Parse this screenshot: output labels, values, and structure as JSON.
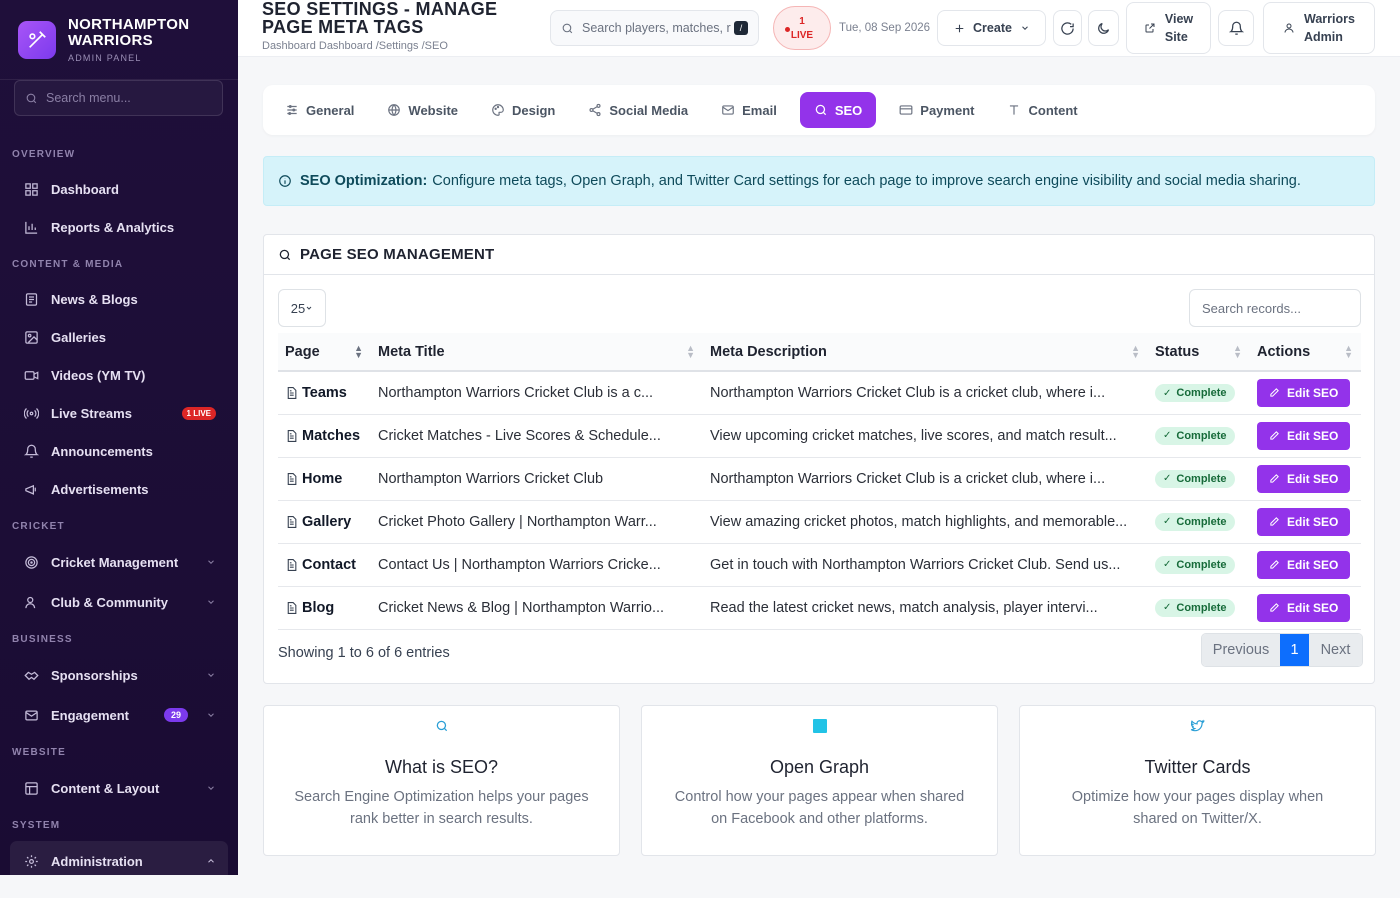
{
  "brand": {
    "name_line1": "NORTHAMPTON",
    "name_line2": "WARRIORS",
    "subtitle": "ADMIN PANEL"
  },
  "sidebar": {
    "search_placeholder": "Search menu...",
    "sections": {
      "overview": "OVERVIEW",
      "content_media": "CONTENT & MEDIA",
      "cricket": "CRICKET",
      "business": "BUSINESS",
      "website": "WEBSITE",
      "system": "SYSTEM"
    },
    "items": {
      "dashboard": "Dashboard",
      "reports": "Reports & Analytics",
      "news": "News & Blogs",
      "galleries": "Galleries",
      "videos": "Videos (YM TV)",
      "live_streams": "Live Streams",
      "live_streams_badge": "1 LIVE",
      "announcements": "Announcements",
      "advertisements": "Advertisements",
      "cricket_management": "Cricket Management",
      "club_community": "Club & Community",
      "sponsorships": "Sponsorships",
      "engagement": "Engagement",
      "engagement_badge": "29",
      "content_layout": "Content & Layout",
      "administration": "Administration"
    }
  },
  "header": {
    "title": "SEO SETTINGS - MANAGE PAGE META TAGS",
    "breadcrumb": "Dashboard  Dashboard  /Settings  /SEO",
    "search_placeholder": "Search players, matches, r",
    "search_kbd": "/",
    "live_count": "1",
    "live_label": "LIVE",
    "date": "Tue, 08 Sep 2026",
    "create_label": "Create",
    "view_site_line1": "View",
    "view_site_line2": "Site",
    "user_line1": "Warriors",
    "user_line2": "Admin"
  },
  "tabs": [
    "General",
    "Website",
    "Design",
    "Social Media",
    "Email",
    "SEO",
    "Payment",
    "Content"
  ],
  "alert": {
    "title": "SEO Optimization:",
    "text": "Configure meta tags, Open Graph, and Twitter Card settings for each page to improve search engine visibility and social media sharing."
  },
  "seo_table": {
    "heading": "PAGE SEO MANAGEMENT",
    "page_length": "25",
    "search_placeholder": "Search records...",
    "columns": [
      "Page",
      "Meta Title",
      "Meta Description",
      "Status",
      "Actions"
    ],
    "rows": [
      {
        "page": "Teams",
        "title": "Northampton Warriors Cricket Club is a c...",
        "desc": "Northampton Warriors Cricket Club is a cricket club, where i...",
        "status": "Complete",
        "action": "Edit SEO"
      },
      {
        "page": "Matches",
        "title": "Cricket Matches - Live Scores & Schedule...",
        "desc": "View upcoming cricket matches, live scores, and match result...",
        "status": "Complete",
        "action": "Edit SEO"
      },
      {
        "page": "Home",
        "title": "Northampton Warriors Cricket Club",
        "desc": "Northampton Warriors Cricket Club is a cricket club, where i...",
        "status": "Complete",
        "action": "Edit SEO"
      },
      {
        "page": "Gallery",
        "title": "Cricket Photo Gallery | Northampton Warr...",
        "desc": "View amazing cricket photos, match highlights, and memorable...",
        "status": "Complete",
        "action": "Edit SEO"
      },
      {
        "page": "Contact",
        "title": "Contact Us | Northampton Warriors Cricke...",
        "desc": "Get in touch with Northampton Warriors Cricket Club. Send us...",
        "status": "Complete",
        "action": "Edit SEO"
      },
      {
        "page": "Blog",
        "title": "Cricket News & Blog | Northampton Warrio...",
        "desc": "Read the latest cricket news, match analysis, player intervi...",
        "status": "Complete",
        "action": "Edit SEO"
      }
    ],
    "entries_text": "Showing 1 to 6 of 6 entries",
    "pager": {
      "prev": "Previous",
      "current": "1",
      "next": "Next"
    }
  },
  "info_cards": [
    {
      "icon": "search-icon",
      "title": "What is SEO?",
      "text": "Search Engine Optimization helps your pages rank better in search results."
    },
    {
      "icon": "open-graph-icon",
      "title": "Open Graph",
      "text": "Control how your pages appear when shared on Facebook and other platforms."
    },
    {
      "icon": "twitter-icon",
      "title": "Twitter Cards",
      "text": "Optimize how your pages display when shared on Twitter/X."
    }
  ],
  "colors": {
    "accent": "#9333ea",
    "sidebar_bg": "#1f0f3a",
    "alert_bg": "#d6f3fa",
    "status_bg": "#d8f5e6",
    "pager_active": "#0d6efd"
  }
}
